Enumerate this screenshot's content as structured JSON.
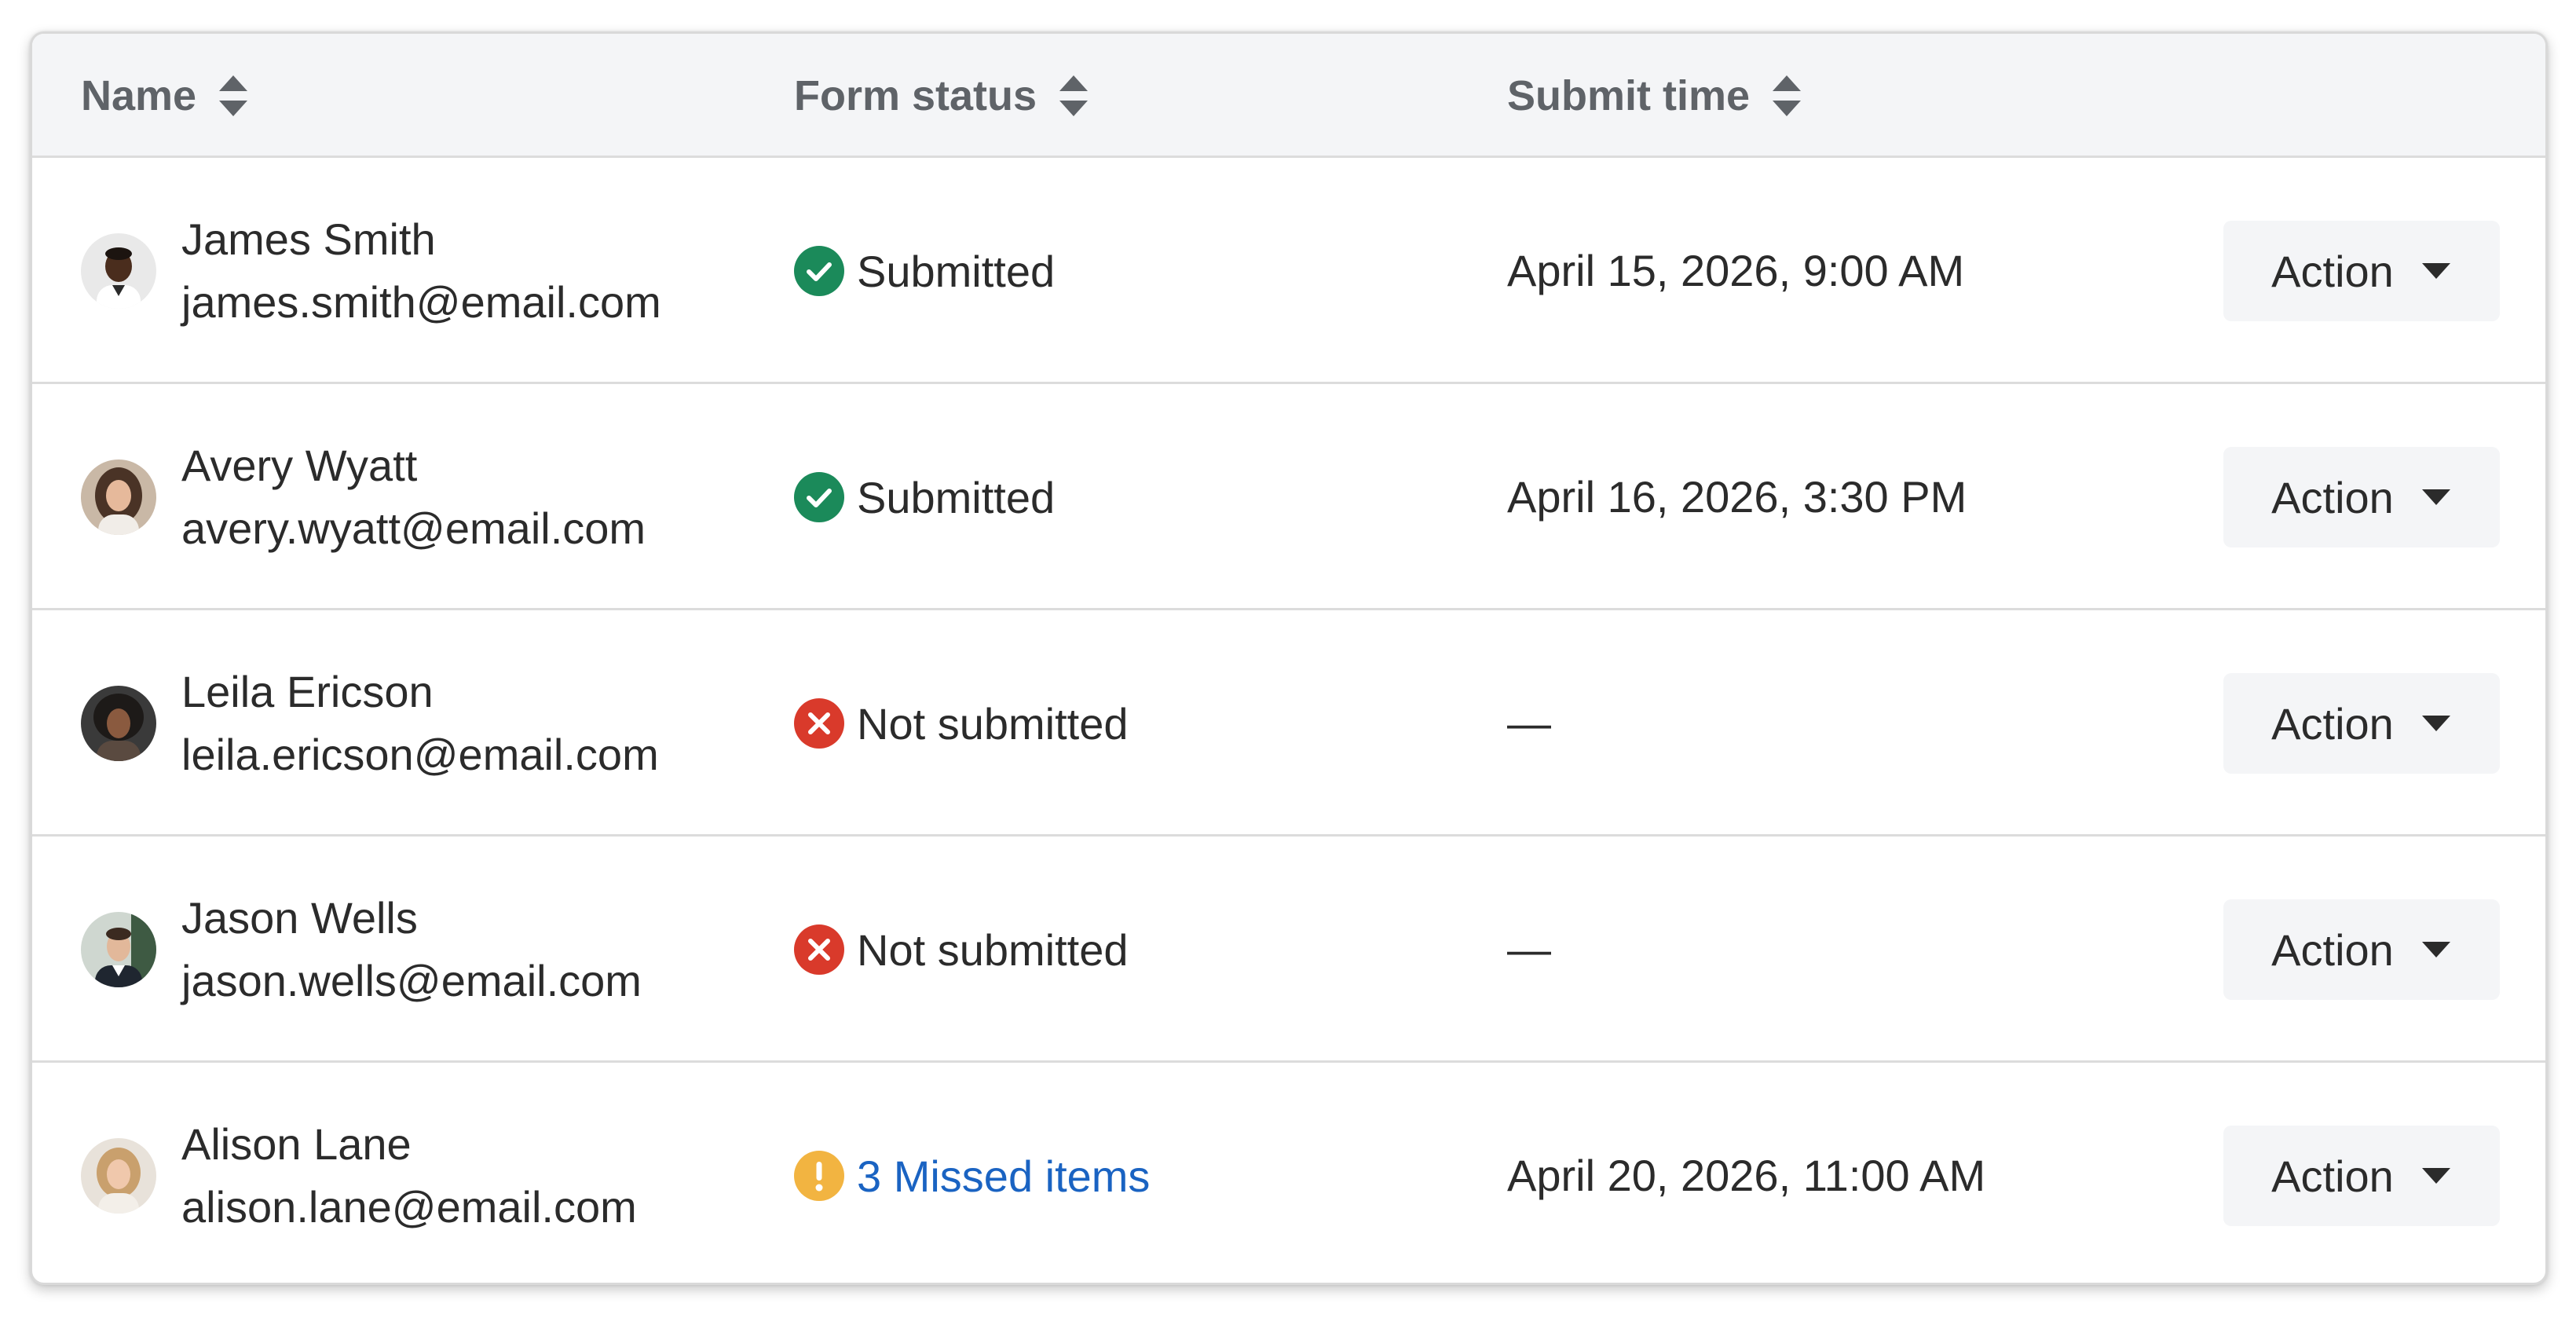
{
  "table": {
    "columns": [
      {
        "label": "Name",
        "sort_icon": "sort-icon"
      },
      {
        "label": "Form status",
        "sort_icon": "sort-icon"
      },
      {
        "label": "Submit time",
        "sort_icon": "sort-icon"
      }
    ],
    "rows": [
      {
        "name": "James Smith",
        "email": "james.smith@email.com",
        "status": "Submitted",
        "status_type": "success",
        "submit_time": "April 15, 2026, 9:00 AM",
        "action": "Action"
      },
      {
        "name": "Avery Wyatt",
        "email": "avery.wyatt@email.com",
        "status": "Submitted",
        "status_type": "success",
        "submit_time": "April 16, 2026, 3:30 PM",
        "action": "Action"
      },
      {
        "name": "Leila Ericson",
        "email": "leila.ericson@email.com",
        "status": "Not submitted",
        "status_type": "error",
        "submit_time": "—",
        "action": "Action"
      },
      {
        "name": "Jason Wells",
        "email": "jason.wells@email.com",
        "status": "Not submitted",
        "status_type": "error",
        "submit_time": "—",
        "action": "Action"
      },
      {
        "name": "Alison Lane",
        "email": "alison.lane@email.com",
        "status": "3 Missed items",
        "status_type": "warning",
        "submit_time": "April 20, 2026, 11:00 AM",
        "action": "Action"
      }
    ]
  },
  "colors": {
    "success": "#1b8a5a",
    "error": "#d93a2b",
    "warning": "#f2b441",
    "link": "#1a63c2",
    "header_bg": "#f4f5f7",
    "header_text": "#5f6368",
    "body_text": "#2b2b2b"
  }
}
